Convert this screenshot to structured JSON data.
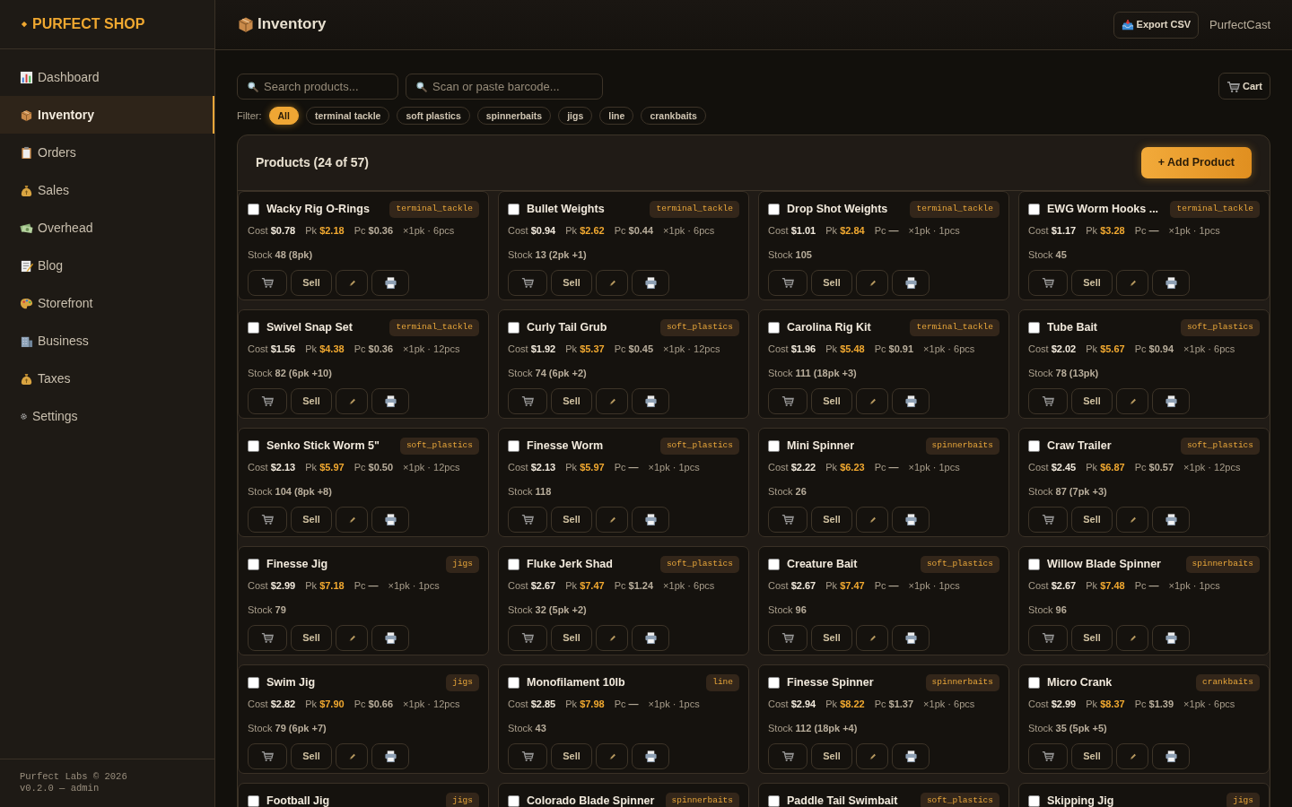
{
  "sidebar": {
    "brand": "PURFECT SHOP",
    "items": [
      {
        "label": "Dashboard",
        "selected": false
      },
      {
        "label": "Inventory",
        "selected": true
      },
      {
        "label": "Orders",
        "selected": false
      },
      {
        "label": "Sales",
        "selected": false
      },
      {
        "label": "Overhead",
        "selected": false
      },
      {
        "label": "Blog",
        "selected": false
      },
      {
        "label": "Storefront",
        "selected": false
      },
      {
        "label": "Business",
        "selected": false
      },
      {
        "label": "Taxes",
        "selected": false
      },
      {
        "label": "Settings",
        "selected": false
      }
    ],
    "footer": [
      "Purfect Labs © 2026",
      "v0.2.0 — admin"
    ]
  },
  "header": {
    "title": "Inventory",
    "export_button": "Export CSV",
    "user": "PurfectCast"
  },
  "search": {
    "placeholder": "Search products..."
  },
  "barcode": {
    "placeholder": "Scan or paste barcode..."
  },
  "cart_button": "Cart",
  "filter": {
    "label": "Filter:",
    "chips": [
      {
        "label": "All",
        "selected": true
      },
      {
        "label": "terminal tackle",
        "selected": false
      },
      {
        "label": "soft plastics",
        "selected": false
      },
      {
        "label": "spinnerbaits",
        "selected": false
      },
      {
        "label": "jigs",
        "selected": false
      },
      {
        "label": "line",
        "selected": false
      },
      {
        "label": "crankbaits",
        "selected": false
      }
    ]
  },
  "panel": {
    "title": "Products (24 of 57)",
    "add_button": "+ Add Product"
  },
  "products": [
    {
      "name": "Wacky Rig O-Rings",
      "tag": "terminal_tackle",
      "checked": false,
      "cost_label": "Cost",
      "cost": "$0.78",
      "pk_label": "Pk",
      "pk": "$2.18",
      "pc_label": "Pc",
      "pc": "$0.36",
      "units": "×1pk · 6pcs",
      "stock_label": "Stock",
      "stock": "48 (8pk)",
      "sell": "Sell"
    },
    {
      "name": "Bullet Weights",
      "tag": "terminal_tackle",
      "checked": false,
      "cost_label": "Cost",
      "cost": "$0.94",
      "pk_label": "Pk",
      "pk": "$2.62",
      "pc_label": "Pc",
      "pc": "$0.44",
      "units": "×1pk · 6pcs",
      "stock_label": "Stock",
      "stock": "13 (2pk +1)",
      "sell": "Sell"
    },
    {
      "name": "Drop Shot Weights",
      "tag": "terminal_tackle",
      "checked": false,
      "cost_label": "Cost",
      "cost": "$1.01",
      "pk_label": "Pk",
      "pk": "$2.84",
      "pc_label": "Pc",
      "pc": "—",
      "units": "×1pk · 1pcs",
      "stock_label": "Stock",
      "stock": "105",
      "sell": "Sell"
    },
    {
      "name": "EWG Worm Hooks ...",
      "tag": "terminal_tackle",
      "checked": false,
      "cost_label": "Cost",
      "cost": "$1.17",
      "pk_label": "Pk",
      "pk": "$3.28",
      "pc_label": "Pc",
      "pc": "—",
      "units": "×1pk · 1pcs",
      "stock_label": "Stock",
      "stock": "45",
      "sell": "Sell"
    },
    {
      "name": "Swivel Snap Set",
      "tag": "terminal_tackle",
      "checked": false,
      "cost_label": "Cost",
      "cost": "$1.56",
      "pk_label": "Pk",
      "pk": "$4.38",
      "pc_label": "Pc",
      "pc": "$0.36",
      "units": "×1pk · 12pcs",
      "stock_label": "Stock",
      "stock": "82 (6pk +10)",
      "sell": "Sell"
    },
    {
      "name": "Curly Tail Grub",
      "tag": "soft_plastics",
      "checked": false,
      "cost_label": "Cost",
      "cost": "$1.92",
      "pk_label": "Pk",
      "pk": "$5.37",
      "pc_label": "Pc",
      "pc": "$0.45",
      "units": "×1pk · 12pcs",
      "stock_label": "Stock",
      "stock": "74 (6pk +2)",
      "sell": "Sell"
    },
    {
      "name": "Carolina Rig Kit",
      "tag": "terminal_tackle",
      "checked": false,
      "cost_label": "Cost",
      "cost": "$1.96",
      "pk_label": "Pk",
      "pk": "$5.48",
      "pc_label": "Pc",
      "pc": "$0.91",
      "units": "×1pk · 6pcs",
      "stock_label": "Stock",
      "stock": "111 (18pk +3)",
      "sell": "Sell"
    },
    {
      "name": "Tube Bait",
      "tag": "soft_plastics",
      "checked": false,
      "cost_label": "Cost",
      "cost": "$2.02",
      "pk_label": "Pk",
      "pk": "$5.67",
      "pc_label": "Pc",
      "pc": "$0.94",
      "units": "×1pk · 6pcs",
      "stock_label": "Stock",
      "stock": "78 (13pk)",
      "sell": "Sell"
    },
    {
      "name": "Senko Stick Worm 5\"",
      "tag": "soft_plastics",
      "checked": false,
      "cost_label": "Cost",
      "cost": "$2.13",
      "pk_label": "Pk",
      "pk": "$5.97",
      "pc_label": "Pc",
      "pc": "$0.50",
      "units": "×1pk · 12pcs",
      "stock_label": "Stock",
      "stock": "104 (8pk +8)",
      "sell": "Sell"
    },
    {
      "name": "Finesse Worm",
      "tag": "soft_plastics",
      "checked": false,
      "cost_label": "Cost",
      "cost": "$2.13",
      "pk_label": "Pk",
      "pk": "$5.97",
      "pc_label": "Pc",
      "pc": "—",
      "units": "×1pk · 1pcs",
      "stock_label": "Stock",
      "stock": "118",
      "sell": "Sell"
    },
    {
      "name": "Mini Spinner",
      "tag": "spinnerbaits",
      "checked": false,
      "cost_label": "Cost",
      "cost": "$2.22",
      "pk_label": "Pk",
      "pk": "$6.23",
      "pc_label": "Pc",
      "pc": "—",
      "units": "×1pk · 1pcs",
      "stock_label": "Stock",
      "stock": "26",
      "sell": "Sell"
    },
    {
      "name": "Craw Trailer",
      "tag": "soft_plastics",
      "checked": false,
      "cost_label": "Cost",
      "cost": "$2.45",
      "pk_label": "Pk",
      "pk": "$6.87",
      "pc_label": "Pc",
      "pc": "$0.57",
      "units": "×1pk · 12pcs",
      "stock_label": "Stock",
      "stock": "87 (7pk +3)",
      "sell": "Sell"
    },
    {
      "name": "Finesse Jig",
      "tag": "jigs",
      "checked": false,
      "cost_label": "Cost",
      "cost": "$2.99",
      "pk_label": "Pk",
      "pk": "$7.18",
      "pc_label": "Pc",
      "pc": "—",
      "units": "×1pk · 1pcs",
      "stock_label": "Stock",
      "stock": "79",
      "sell": "Sell"
    },
    {
      "name": "Fluke Jerk Shad",
      "tag": "soft_plastics",
      "checked": false,
      "cost_label": "Cost",
      "cost": "$2.67",
      "pk_label": "Pk",
      "pk": "$7.47",
      "pc_label": "Pc",
      "pc": "$1.24",
      "units": "×1pk · 6pcs",
      "stock_label": "Stock",
      "stock": "32 (5pk +2)",
      "sell": "Sell"
    },
    {
      "name": "Creature Bait",
      "tag": "soft_plastics",
      "checked": false,
      "cost_label": "Cost",
      "cost": "$2.67",
      "pk_label": "Pk",
      "pk": "$7.47",
      "pc_label": "Pc",
      "pc": "—",
      "units": "×1pk · 1pcs",
      "stock_label": "Stock",
      "stock": "96",
      "sell": "Sell"
    },
    {
      "name": "Willow Blade Spinner",
      "tag": "spinnerbaits",
      "checked": false,
      "cost_label": "Cost",
      "cost": "$2.67",
      "pk_label": "Pk",
      "pk": "$7.48",
      "pc_label": "Pc",
      "pc": "—",
      "units": "×1pk · 1pcs",
      "stock_label": "Stock",
      "stock": "96",
      "sell": "Sell"
    },
    {
      "name": "Swim Jig",
      "tag": "jigs",
      "checked": false,
      "cost_label": "Cost",
      "cost": "$2.82",
      "pk_label": "Pk",
      "pk": "$7.90",
      "pc_label": "Pc",
      "pc": "$0.66",
      "units": "×1pk · 12pcs",
      "stock_label": "Stock",
      "stock": "79 (6pk +7)",
      "sell": "Sell"
    },
    {
      "name": "Monofilament 10lb",
      "tag": "line",
      "checked": false,
      "cost_label": "Cost",
      "cost": "$2.85",
      "pk_label": "Pk",
      "pk": "$7.98",
      "pc_label": "Pc",
      "pc": "—",
      "units": "×1pk · 1pcs",
      "stock_label": "Stock",
      "stock": "43",
      "sell": "Sell"
    },
    {
      "name": "Finesse Spinner",
      "tag": "spinnerbaits",
      "checked": false,
      "cost_label": "Cost",
      "cost": "$2.94",
      "pk_label": "Pk",
      "pk": "$8.22",
      "pc_label": "Pc",
      "pc": "$1.37",
      "units": "×1pk · 6pcs",
      "stock_label": "Stock",
      "stock": "112 (18pk +4)",
      "sell": "Sell"
    },
    {
      "name": "Micro Crank",
      "tag": "crankbaits",
      "checked": false,
      "cost_label": "Cost",
      "cost": "$2.99",
      "pk_label": "Pk",
      "pk": "$8.37",
      "pc_label": "Pc",
      "pc": "$1.39",
      "units": "×1pk · 6pcs",
      "stock_label": "Stock",
      "stock": "35 (5pk +5)",
      "sell": "Sell"
    },
    {
      "name": "Football Jig",
      "tag": "jigs",
      "checked": false
    },
    {
      "name": "Colorado Blade Spinner",
      "tag": "spinnerbaits",
      "checked": false
    },
    {
      "name": "Paddle Tail Swimbait",
      "tag": "soft_plastics",
      "checked": false
    },
    {
      "name": "Skipping Jig",
      "tag": "jigs",
      "checked": false
    }
  ]
}
